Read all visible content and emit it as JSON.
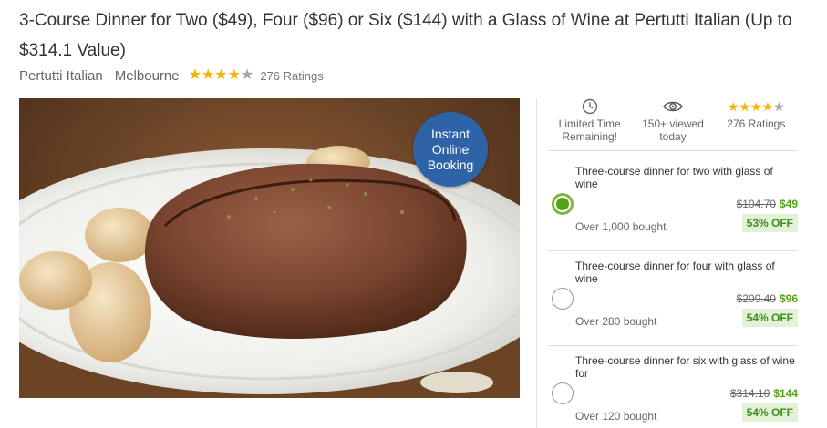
{
  "deal": {
    "title": "3-Course Dinner for Two ($49), Four ($96) or Six ($144) with a Glass of Wine at Pertutti Italian (Up to $314.1 Value)",
    "merchant": "Pertutti Italian",
    "location": "Melbourne",
    "rating_stars": 4,
    "rating_max": 5,
    "ratings_text": "276 Ratings"
  },
  "hero": {
    "badge_line1": "Instant",
    "badge_line2": "Online",
    "badge_line3": "Booking"
  },
  "stats": {
    "time_icon": "clock-icon",
    "time_line1": "Limited Time",
    "time_line2": "Remaining!",
    "views_icon": "eye-icon",
    "views_line1": "150+ viewed",
    "views_line2": "today",
    "ratings_text": "276 Ratings"
  },
  "options": [
    {
      "title": "Three-course dinner for two with glass of wine",
      "old_price": "$104.70",
      "new_price": "$49",
      "bought": "Over 1,000 bought",
      "discount": "53% OFF",
      "selected": true
    },
    {
      "title": "Three-course dinner for four with glass of wine",
      "old_price": "$209.40",
      "new_price": "$96",
      "bought": "Over 280 bought",
      "discount": "54% OFF",
      "selected": false
    },
    {
      "title": "Three-course dinner for six with glass of wine for",
      "old_price": "$314.10",
      "new_price": "$144",
      "bought": "Over 120 bought",
      "discount": "54% OFF",
      "selected": false
    }
  ],
  "colors": {
    "accent_green": "#53a318",
    "star_gold": "#f5b301",
    "badge_blue": "#2f63a8"
  }
}
